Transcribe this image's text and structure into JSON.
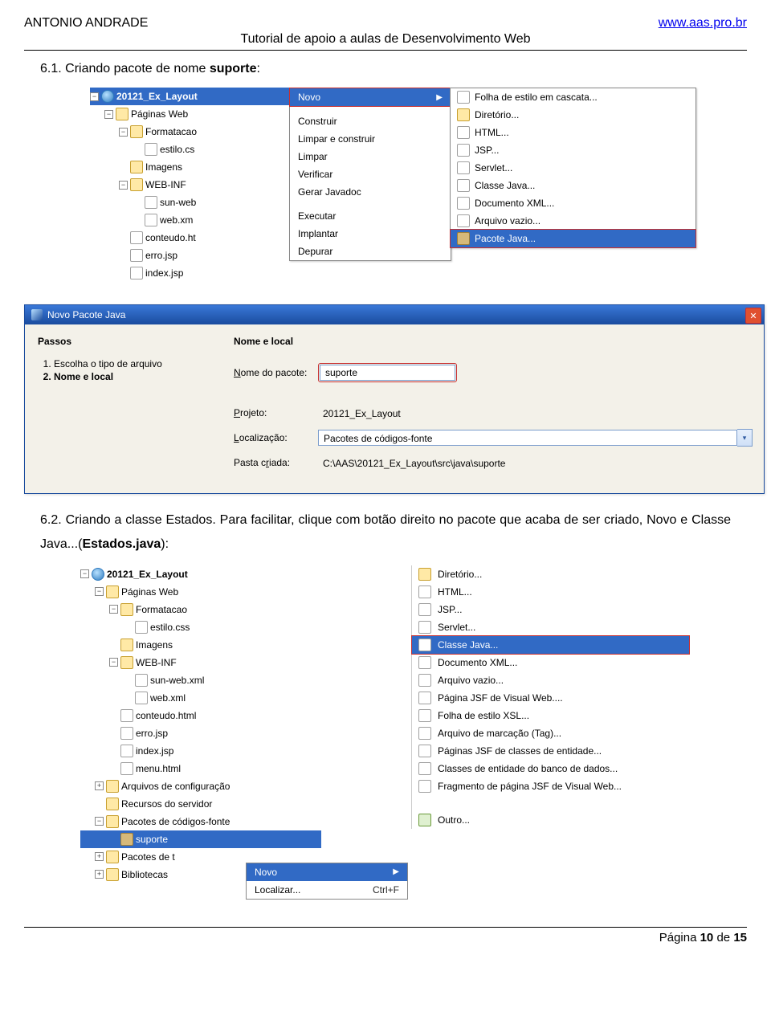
{
  "header": {
    "author": "ANTONIO ANDRADE",
    "url": "www.aas.pro.br",
    "subtitle": "Tutorial de apoio a aulas de Desenvolvimento Web"
  },
  "section1": {
    "num": "6.1.",
    "text": "Criando pacote de nome ",
    "bold": "suporte",
    "suffix": ":"
  },
  "tree1": {
    "project": "20121_Ex_Layout",
    "items": [
      "Páginas Web",
      "Formatacao",
      "estilo.cs",
      "Imagens",
      "WEB-INF",
      "sun-web",
      "web.xm",
      "conteudo.ht",
      "erro.jsp",
      "index.jsp"
    ]
  },
  "ctx1": {
    "items": [
      "Novo",
      "Construir",
      "Limpar e construir",
      "Limpar",
      "Verificar",
      "Gerar Javadoc",
      "Executar",
      "Implantar",
      "Depurar"
    ]
  },
  "submenu1": {
    "items": [
      "Folha de estilo em cascata...",
      "Diretório...",
      "HTML...",
      "JSP...",
      "Servlet...",
      "Classe Java...",
      "Documento XML...",
      "Arquivo vazio...",
      "Pacote Java..."
    ]
  },
  "dialog": {
    "title": "Novo Pacote Java",
    "steps_title": "Passos",
    "step1": "Escolha o tipo de arquivo",
    "step2": "Nome e local",
    "form_title": "Nome e local",
    "labels": {
      "nome": "Nome do pacote:",
      "projeto": "Projeto:",
      "local": "Localização:",
      "pasta": "Pasta criada:"
    },
    "values": {
      "nome": "suporte",
      "projeto": "20121_Ex_Layout",
      "local": "Pacotes de códigos-fonte",
      "pasta": "C:\\AAS\\20121_Ex_Layout\\src\\java\\suporte"
    }
  },
  "section2": {
    "num": "6.2.",
    "text1": "Criando a classe Estados. Para facilitar, clique com botão direito no pacote que acaba de ser criado, Novo e Classe Java...(",
    "bold": "Estados.java",
    "text2": "):"
  },
  "tree2": {
    "project": "20121_Ex_Layout",
    "items": [
      "Páginas Web",
      "Formatacao",
      "estilo.css",
      "Imagens",
      "WEB-INF",
      "sun-web.xml",
      "web.xml",
      "conteudo.html",
      "erro.jsp",
      "index.jsp",
      "menu.html",
      "Arquivos de configuração",
      "Recursos do servidor",
      "Pacotes de códigos-fonte",
      "suporte",
      "Pacotes de t",
      "Bibliotecas"
    ]
  },
  "files2": {
    "items": [
      "Diretório...",
      "HTML...",
      "JSP...",
      "Servlet...",
      "Classe Java...",
      "Documento XML...",
      "Arquivo vazio...",
      "Página JSF de Visual Web....",
      "Folha de estilo XSL...",
      "Arquivo de marcação (Tag)...",
      "Páginas JSF de classes de entidade...",
      "Classes de entidade do banco de dados...",
      "Fragmento de página JSF de Visual Web...",
      "Outro..."
    ]
  },
  "ctx2": {
    "items": [
      {
        "label": "Novo",
        "shortcut": ""
      },
      {
        "label": "Localizar...",
        "shortcut": "Ctrl+F"
      }
    ]
  },
  "footer": {
    "page": "Página 10 de 15"
  }
}
